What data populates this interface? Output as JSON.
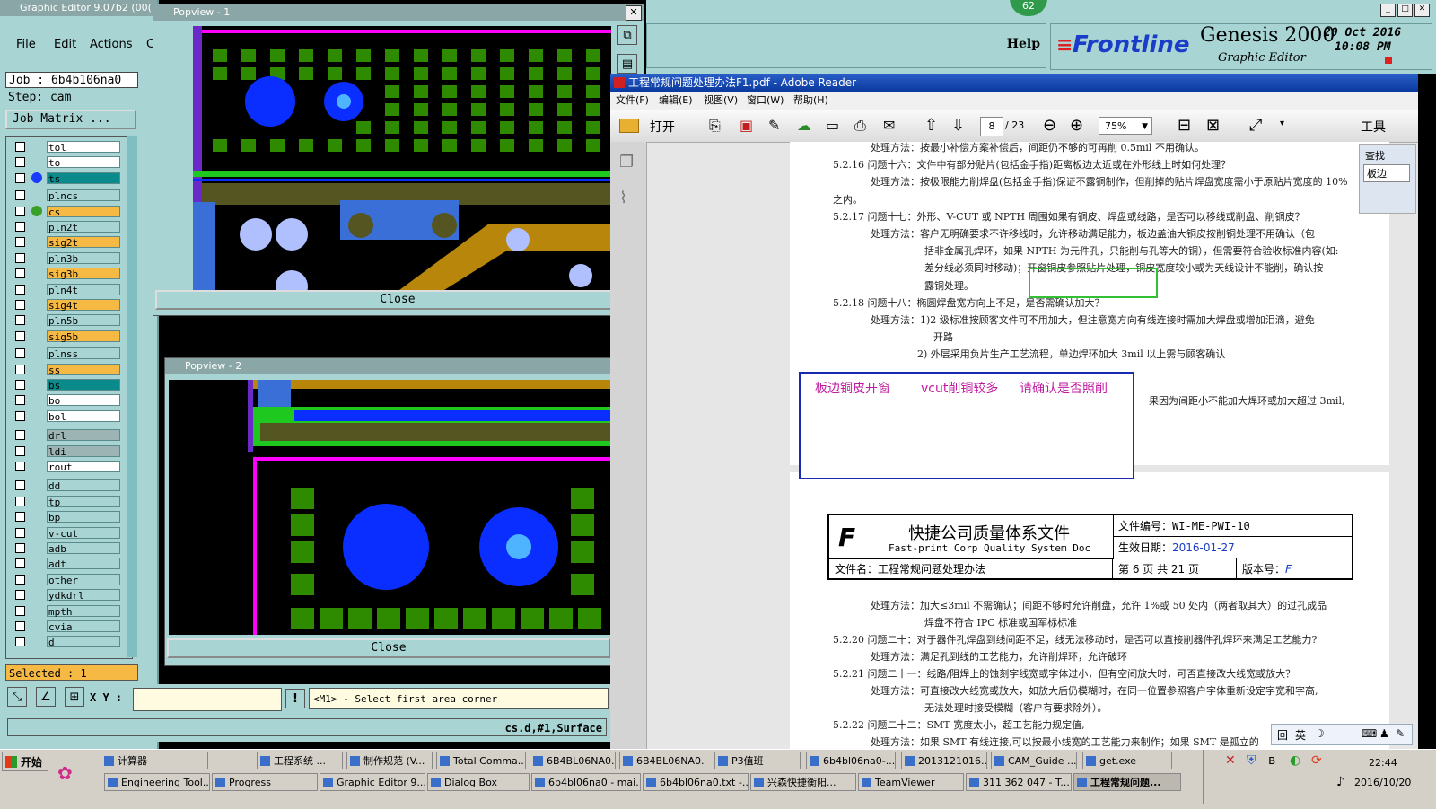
{
  "genesis": {
    "title": "Graphic Editor 9.07b2 (00(",
    "menu": [
      "File",
      "Edit",
      "Actions",
      "C"
    ],
    "job": "Job : 6b4b106na0",
    "step": "Step: cam",
    "job_matrix": "Job Matrix ...",
    "layers": [
      {
        "name": "tol",
        "color": "#ffffff",
        "dot": ""
      },
      {
        "name": "to",
        "color": "#ffffff",
        "dot": ""
      },
      {
        "name": "ts",
        "color": "#0a8a8a",
        "dot": "#1a3cff"
      },
      {
        "name": "plncs",
        "color": "#a8d4d4",
        "dot": ""
      },
      {
        "name": "cs",
        "color": "#f5b944",
        "dot": "#3aa02a"
      },
      {
        "name": "pln2t",
        "color": "#a8d4d4",
        "dot": ""
      },
      {
        "name": "sig2t",
        "color": "#f5b944",
        "dot": ""
      },
      {
        "name": "pln3b",
        "color": "#a8d4d4",
        "dot": ""
      },
      {
        "name": "sig3b",
        "color": "#f5b944",
        "dot": ""
      },
      {
        "name": "pln4t",
        "color": "#a8d4d4",
        "dot": ""
      },
      {
        "name": "sig4t",
        "color": "#f5b944",
        "dot": ""
      },
      {
        "name": "pln5b",
        "color": "#a8d4d4",
        "dot": ""
      },
      {
        "name": "sig5b",
        "color": "#f5b944",
        "dot": ""
      },
      {
        "name": "plnss",
        "color": "#a8d4d4",
        "dot": ""
      },
      {
        "name": "ss",
        "color": "#f5b944",
        "dot": ""
      },
      {
        "name": "bs",
        "color": "#0a8a8a",
        "dot": ""
      },
      {
        "name": "bo",
        "color": "#ffffff",
        "dot": ""
      },
      {
        "name": "bol",
        "color": "#ffffff",
        "dot": ""
      },
      {
        "name": "drl",
        "color": "#9cb4b4",
        "dot": ""
      },
      {
        "name": "ldi",
        "color": "#9cb4b4",
        "dot": ""
      },
      {
        "name": "rout",
        "color": "#ffffff",
        "dot": ""
      },
      {
        "name": "dd",
        "color": "#a8d4d4",
        "dot": ""
      },
      {
        "name": "tp",
        "color": "#a8d4d4",
        "dot": ""
      },
      {
        "name": "bp",
        "color": "#a8d4d4",
        "dot": ""
      },
      {
        "name": "v-cut",
        "color": "#a8d4d4",
        "dot": ""
      },
      {
        "name": "adb",
        "color": "#a8d4d4",
        "dot": ""
      },
      {
        "name": "adt",
        "color": "#a8d4d4",
        "dot": ""
      },
      {
        "name": "other",
        "color": "#a8d4d4",
        "dot": ""
      },
      {
        "name": "ydkdrl",
        "color": "#a8d4d4",
        "dot": ""
      },
      {
        "name": "mpth",
        "color": "#a8d4d4",
        "dot": ""
      },
      {
        "name": "cvia",
        "color": "#a8d4d4",
        "dot": ""
      },
      {
        "name": "d",
        "color": "#a8d4d4",
        "dot": ""
      }
    ],
    "selected": "Selected : 1",
    "xy_label": "X Y :",
    "prompt": "<M1> - Select first area corner",
    "status": "cs.d,#1,Surface",
    "help": "Help",
    "counter": "62",
    "brand": "Frontline",
    "product": "Genesis 2000",
    "subtitle": "Graphic Editor",
    "date": "20 Oct 2016",
    "time": "10:08 PM"
  },
  "popview1": {
    "title": "Popview - 1",
    "close": "Close"
  },
  "popview2": {
    "title": "Popview - 2",
    "close": "Close"
  },
  "reader": {
    "title": "工程常规问题处理办法F1.pdf - Adobe Reader",
    "menu": [
      "文件(F)",
      "编辑(E)",
      "视图(V)",
      "窗口(W)",
      "帮助(H)"
    ],
    "open": "打开",
    "page": "8",
    "pages": "/ 23",
    "zoom": "75%",
    "tools": "工具",
    "find_label": "查找",
    "find_value": "板边",
    "lines": [
      "处理方法：按最小补偿方案补偿后，间距仍不够的可再削 0.5mil 不用确认。",
      "5.2.16  问题十六：文件中有部分贴片(包括金手指)距离板边太近或在外形线上时如何处理？",
      "处理方法：按极限能力削焊盘(包括金手指)保证不露铜制作，但削掉的贴片焊盘宽度需小于原贴片宽度的 10%",
      "之内。",
      "5.2.17  问题十七：外形、V-CUT 或 NPTH 周围如果有铜皮、焊盘或线路，是否可以移线或削盘、削铜皮？",
      "处理方法：客户无明确要求不许移线时，允许移动满足能力，板边盖油大铜皮按削铜处理不用确认（包",
      "括非金属孔焊环，如果 NPTH 为元件孔，只能削与孔等大的铜），但需要符合验收标准内容(如:",
      "差分线必须同时移动)；开窗铜皮参照贴片处理，铜皮宽度较小或为天线设计不能削，确认按",
      "露铜处理。",
      "5.2.18  问题十八：椭圆焊盘宽方向上不足，是否需确认加大？",
      "处理方法：1)2 级标准按顾客文件可不用加大，但注意宽方向有线连接时需加大焊盘或增加泪滴，避免",
      "开路",
      "2) 外层采用负片生产工艺流程，单边焊环加大 3mil 以上需与顾客确认",
      "果因为间距小不能加大焊环或加大超过 3mil,"
    ],
    "note": [
      "板边铜皮开窗",
      "vcut削铜较多",
      "请确认是否照削"
    ],
    "doc_title": "快捷公司质量体系文件",
    "doc_title_en": "Fast-print Corp Quality System Doc",
    "doc_no_label": "文件编号：",
    "doc_no": "WI-ME-PWI-10",
    "eff_label": "生效日期：",
    "eff_date": "2016-01-27",
    "file_label": "文件名：工程常规问题处理办法",
    "page_info": "第 6 页 共 21 页",
    "version_label": "版本号：",
    "version": "F",
    "lines2": [
      "处理方法：加大≤3mil 不需确认；间距不够时允许削盘，允许 1%或 50 处内（两者取其大）的过孔成品",
      "焊盘不符合 IPC 标准或国军标标准",
      "5.2.20  问题二十：对于器件孔焊盘到线间距不足，线无法移动时，是否可以直接削器件孔焊环来满足工艺能力?",
      "处理方法：满足孔到线的工艺能力，允许削焊环，允许破环",
      "5.2.21  问题二十一：线路/阻焊上的蚀刻字线宽或字体过小，但有空间放大时，可否直接改大线宽或放大？",
      "处理方法：可直接改大线宽或放大，如放大后仍模糊时，在同一位置参照客户字体重新设定字宽和字高,",
      "无法处理时接受模糊（客户有要求除外）。",
      "5.2.22  问题二十二：SMT 宽度太小，超工艺能力规定值,",
      "处理方法：如果 SMT 有线连接,可以按最小线宽的工艺能力来制作；如果 SMT 是孤立的"
    ],
    "ime": "英"
  },
  "taskbar": {
    "start": "开始",
    "row1": [
      "计算器",
      "工程系统 ...",
      "制作规范 (V...",
      "Total Comma...",
      "6B4BL06NA0...",
      "6B4BL06NA0...",
      "P3值班",
      "6b4bl06na0-...",
      "2013121016...",
      "CAM_Guide ...",
      "get.exe"
    ],
    "row2": [
      "Engineering Tool...",
      "Progress",
      "Graphic Editor 9....",
      "Dialog Box",
      "6b4bl06na0 - mai...",
      "6b4bl06na0.txt -...",
      "兴森快捷衡阳...",
      "TeamViewer",
      "311 362 047 - T...",
      "工程常规问题..."
    ],
    "time": "22:44",
    "date": "2016/10/20"
  },
  "colors": {
    "pcb_green": "#2e8b00",
    "pad_blue": "#0a2eff",
    "copper": "#b8860b",
    "teal": "#a8d4d4"
  }
}
